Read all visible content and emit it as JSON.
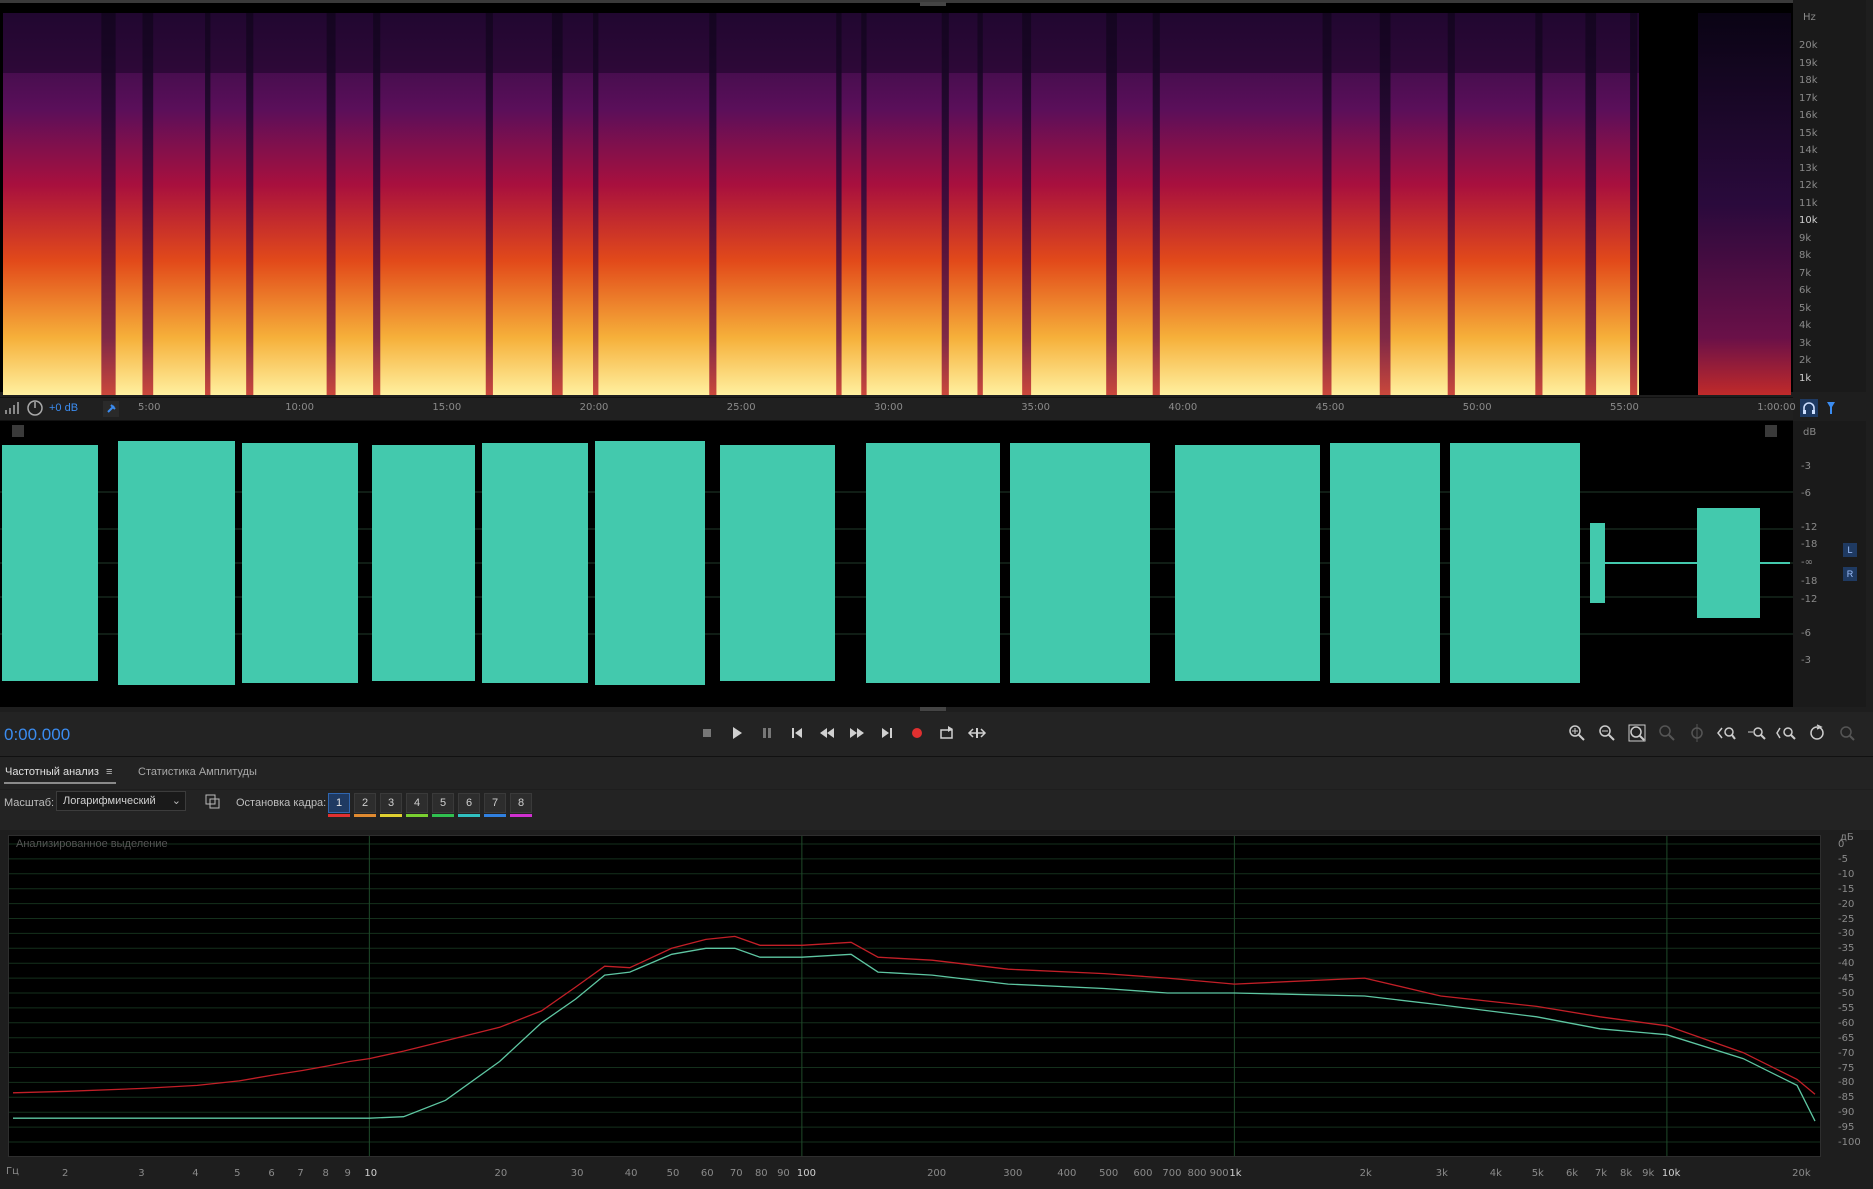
{
  "spectral_axis": {
    "unit": "Hz",
    "labels": [
      "20k",
      "19k",
      "18k",
      "17k",
      "16k",
      "15k",
      "14k",
      "13k",
      "12k",
      "11k",
      "10k",
      "9k",
      "8k",
      "7k",
      "6k",
      "5k",
      "4k",
      "3k",
      "2k",
      "1k"
    ],
    "strong": [
      "10k",
      "1k"
    ]
  },
  "timeline": {
    "gain_label": "+0 dB",
    "ticks": [
      "5:00",
      "10:00",
      "15:00",
      "20:00",
      "25:00",
      "30:00",
      "35:00",
      "40:00",
      "45:00",
      "50:00",
      "55:00",
      "1:00:00"
    ]
  },
  "waveform_axis": {
    "unit": "dB",
    "labels": [
      "-3",
      "-6",
      "-12",
      "-18",
      "-∞",
      "-18",
      "-12",
      "-6",
      "-3"
    ],
    "channels": [
      "L",
      "R"
    ]
  },
  "transport": {
    "timecode": "0:00.000",
    "buttons": [
      "stop",
      "play",
      "pause",
      "go-to-start",
      "rewind",
      "fast-forward",
      "go-to-end",
      "record",
      "loop",
      "skip-selection"
    ]
  },
  "panel_tabs": {
    "active": "Частотный анализ",
    "menu_glyph": "≡",
    "second": "Статистика Амплитуды"
  },
  "controls": {
    "scale_label": "Масштаб:",
    "scale_value": "Логарифмический",
    "freeze_label": "Остановка кадра:",
    "frames": [
      "1",
      "2",
      "3",
      "4",
      "5",
      "6",
      "7",
      "8"
    ],
    "frame_colors": [
      "#e03030",
      "#e08a30",
      "#e0d030",
      "#7ad030",
      "#30c050",
      "#30c0c0",
      "#3080e0",
      "#d030d0"
    ]
  },
  "frequency_analysis": {
    "overlay_label": "Анализированное выделение",
    "y_axis_unit": "дБ",
    "y_labels": [
      "0",
      "-5",
      "-10",
      "-15",
      "-20",
      "-25",
      "-30",
      "-35",
      "-40",
      "-45",
      "-50",
      "-55",
      "-60",
      "-65",
      "-70",
      "-75",
      "-80",
      "-85",
      "-90",
      "-95",
      "-100"
    ],
    "x_axis_unit": "Гц",
    "x_labels": [
      "2",
      "3",
      "4",
      "5",
      "6",
      "7",
      "8",
      "9",
      "10",
      "20",
      "30",
      "40",
      "50",
      "60",
      "70",
      "80",
      "90",
      "100",
      "200",
      "300",
      "400",
      "500",
      "600",
      "700",
      "800",
      "900",
      "1k",
      "2k",
      "3k",
      "4k",
      "5k",
      "6k",
      "7k",
      "8k",
      "9k",
      "10k",
      "20k"
    ],
    "x_strong": [
      "10",
      "100",
      "1k",
      "10k"
    ],
    "colors": {
      "red": "#c21f27",
      "green": "#5ec6a2"
    }
  },
  "chart_data": {
    "type": "line",
    "xlabel": "Гц",
    "ylabel": "дБ",
    "ylim": [
      -100,
      0
    ],
    "x_scale": "log",
    "series": [
      {
        "x": [
          1.5,
          2,
          3,
          4,
          5,
          6,
          7,
          8,
          9,
          10,
          12,
          15,
          20,
          25,
          30,
          35,
          40,
          50,
          60,
          70,
          80,
          100,
          130,
          150,
          200,
          300,
          500,
          700,
          1000,
          2000,
          3000,
          5000,
          7000,
          10000,
          15000,
          20000,
          22000
        ],
        "values": [
          -83.5,
          -83,
          -82,
          -81,
          -79.5,
          -77.5,
          -76,
          -74.5,
          -73,
          -72,
          -69.5,
          -66,
          -61.5,
          -56,
          -48,
          -41,
          -41.5,
          -35,
          -32,
          -31,
          -34,
          -34,
          -33,
          -38,
          -39,
          -42,
          -43.5,
          -45,
          -47,
          -45,
          -51,
          -54.5,
          -58,
          -61,
          -70,
          -79,
          -84
        ]
      },
      {
        "x": [
          1.5,
          2,
          3,
          4,
          5,
          6,
          7,
          8,
          9,
          10,
          12,
          15,
          20,
          25,
          30,
          35,
          40,
          50,
          60,
          70,
          80,
          100,
          130,
          150,
          200,
          300,
          500,
          700,
          1000,
          2000,
          3000,
          5000,
          7000,
          10000,
          15000,
          20000,
          22000
        ],
        "values": [
          -92,
          -92,
          -92,
          -92,
          -92,
          -92,
          -92,
          -92,
          -92,
          -92,
          -91.5,
          -86,
          -73,
          -60,
          -52,
          -44,
          -43,
          -37,
          -35,
          -35,
          -38,
          -38,
          -37,
          -43,
          -44,
          -47,
          -48.5,
          -50,
          -50,
          -51,
          -54,
          -58,
          -62,
          -64,
          -72,
          -81,
          -93
        ]
      }
    ]
  }
}
